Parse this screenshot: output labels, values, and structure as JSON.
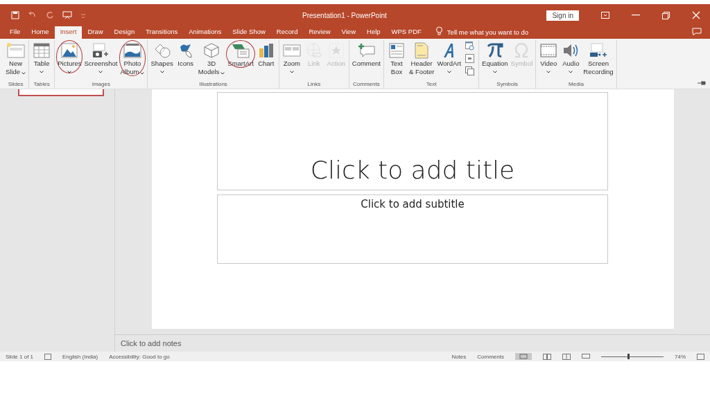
{
  "window": {
    "title": "Presentation1  -  PowerPoint",
    "sign_in": "Sign in"
  },
  "tabs": [
    {
      "label": "File",
      "selected": false
    },
    {
      "label": "Home",
      "selected": false
    },
    {
      "label": "Insert",
      "selected": true
    },
    {
      "label": "Draw",
      "selected": false
    },
    {
      "label": "Design",
      "selected": false
    },
    {
      "label": "Transitions",
      "selected": false
    },
    {
      "label": "Animations",
      "selected": false
    },
    {
      "label": "Slide Show",
      "selected": false
    },
    {
      "label": "Record",
      "selected": false
    },
    {
      "label": "Review",
      "selected": false
    },
    {
      "label": "View",
      "selected": false
    },
    {
      "label": "Help",
      "selected": false
    },
    {
      "label": "WPS PDF",
      "selected": false
    }
  ],
  "tell_me": {
    "placeholder": "Tell me what you want to do"
  },
  "ribbon": [
    {
      "label": "Slides",
      "buttons": [
        {
          "kind": "slide",
          "lines": [
            "New",
            "Slide"
          ],
          "dropdown": true,
          "disabled": false,
          "circled": false
        }
      ]
    },
    {
      "label": "Tables",
      "buttons": [
        {
          "kind": "table",
          "lines": [
            "Table"
          ],
          "dropdown": true,
          "disabled": false,
          "circled": false
        }
      ]
    },
    {
      "label": "Images",
      "buttons": [
        {
          "kind": "pictures",
          "lines": [
            "Pictures"
          ],
          "dropdown": true,
          "disabled": false,
          "circled": true
        },
        {
          "kind": "screenshot",
          "lines": [
            "Screenshot"
          ],
          "dropdown": true,
          "disabled": false,
          "circled": false
        },
        {
          "kind": "album",
          "lines": [
            "Photo",
            "Album"
          ],
          "dropdown": true,
          "disabled": false,
          "circled": true
        }
      ]
    },
    {
      "label": "Illustrations",
      "buttons": [
        {
          "kind": "shapes",
          "lines": [
            "Shapes"
          ],
          "dropdown": true,
          "disabled": false,
          "circled": false
        },
        {
          "kind": "icons",
          "lines": [
            "Icons"
          ],
          "dropdown": false,
          "disabled": false,
          "circled": false
        },
        {
          "kind": "cube",
          "lines": [
            "3D",
            "Models"
          ],
          "dropdown": true,
          "disabled": false,
          "circled": false
        },
        {
          "kind": "smartart",
          "lines": [
            "SmartArt"
          ],
          "dropdown": false,
          "disabled": false,
          "circled": true
        },
        {
          "kind": "chart",
          "lines": [
            "Chart"
          ],
          "dropdown": false,
          "disabled": false,
          "circled": false
        }
      ]
    },
    {
      "label": "Links",
      "buttons": [
        {
          "kind": "zoom",
          "lines": [
            "Zoom"
          ],
          "dropdown": true,
          "disabled": false,
          "circled": false
        },
        {
          "kind": "link",
          "lines": [
            "Link"
          ],
          "dropdown": false,
          "disabled": true,
          "circled": false
        },
        {
          "kind": "action",
          "lines": [
            "Action"
          ],
          "dropdown": false,
          "disabled": true,
          "circled": false
        }
      ]
    },
    {
      "label": "Comments",
      "buttons": [
        {
          "kind": "comment",
          "lines": [
            "Comment"
          ],
          "dropdown": false,
          "disabled": false,
          "circled": false
        }
      ]
    },
    {
      "label": "Text",
      "buttons": [
        {
          "kind": "textbox",
          "lines": [
            "Text",
            "Box"
          ],
          "dropdown": false,
          "disabled": false,
          "circled": false
        },
        {
          "kind": "header",
          "lines": [
            "Header",
            "& Footer"
          ],
          "dropdown": false,
          "disabled": false,
          "circled": false
        },
        {
          "kind": "wordart",
          "lines": [
            "WordArt"
          ],
          "dropdown": true,
          "disabled": false,
          "circled": false
        },
        {
          "kind": "small-stack"
        }
      ]
    },
    {
      "label": "Symbols",
      "buttons": [
        {
          "kind": "pi",
          "lines": [
            "Equation"
          ],
          "dropdown": true,
          "disabled": false,
          "circled": false
        },
        {
          "kind": "omega",
          "lines": [
            "Symbol"
          ],
          "dropdown": false,
          "disabled": true,
          "circled": false
        }
      ]
    },
    {
      "label": "Media",
      "buttons": [
        {
          "kind": "video",
          "lines": [
            "Video"
          ],
          "dropdown": true,
          "disabled": false,
          "circled": false
        },
        {
          "kind": "audio",
          "lines": [
            "Audio"
          ],
          "dropdown": true,
          "disabled": false,
          "circled": false
        },
        {
          "kind": "record",
          "lines": [
            "Screen",
            "Recording"
          ],
          "dropdown": false,
          "disabled": false,
          "circled": false
        }
      ]
    }
  ],
  "slide": {
    "title_placeholder": "Click to add title",
    "subtitle_placeholder": "Click to add subtitle"
  },
  "notes": {
    "placeholder": "Click to add notes"
  },
  "status_bar": {
    "slide": "Slide 1 of 1",
    "language": "English (India)",
    "accessibility": "Accessibility: Good to go",
    "notes": "Notes",
    "comments": "Comments",
    "zoom": {
      "level": 0.42,
      "reading": "74%"
    }
  }
}
